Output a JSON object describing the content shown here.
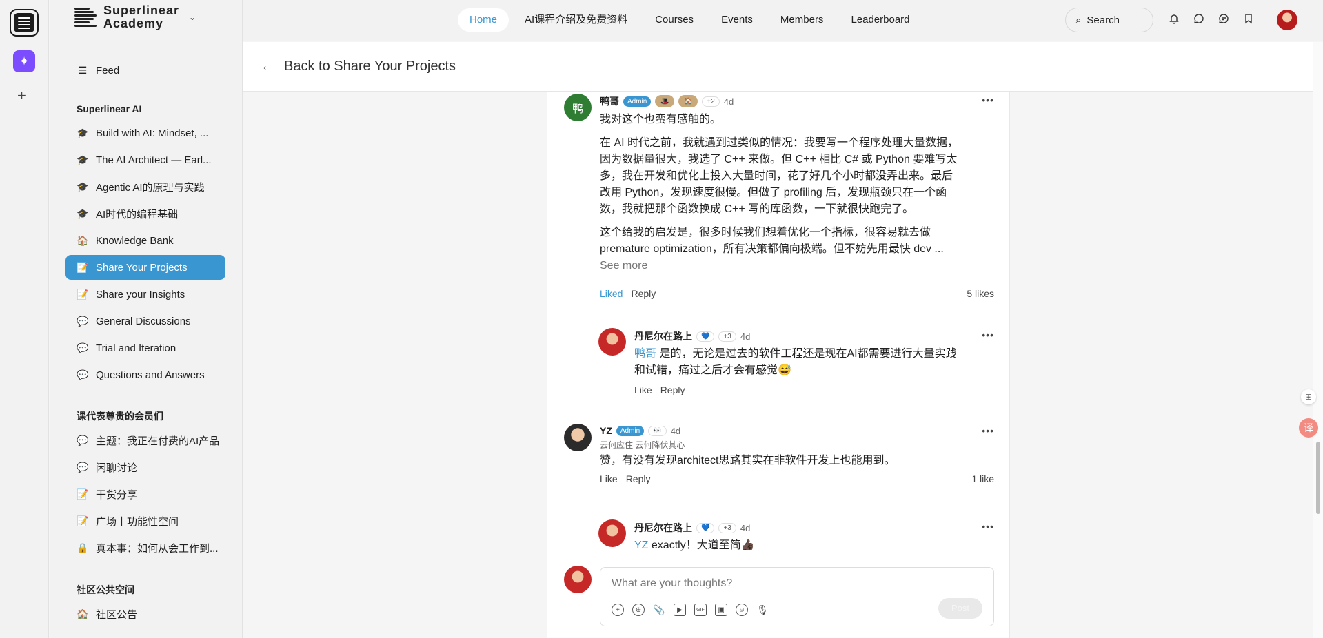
{
  "app": {
    "brand_line1": "Superlinear",
    "brand_line2": "Academy"
  },
  "nav": {
    "tabs": [
      {
        "label": "Home",
        "active": true
      },
      {
        "label": "AI课程介绍及免费资料"
      },
      {
        "label": "Courses"
      },
      {
        "label": "Events"
      },
      {
        "label": "Members"
      },
      {
        "label": "Leaderboard"
      }
    ],
    "search_label": "Search"
  },
  "sidebar": {
    "feed": "Feed",
    "section1": "Superlinear AI",
    "section1_items": [
      {
        "icon": "🎓",
        "label": "Build with AI: Mindset, ..."
      },
      {
        "icon": "🎓",
        "label": "The AI Architect — Earl..."
      },
      {
        "icon": "🎓",
        "label": "Agentic AI的原理与实践"
      },
      {
        "icon": "🎓",
        "label": "AI时代的编程基础"
      },
      {
        "icon": "🏠",
        "label": "Knowledge Bank"
      },
      {
        "icon": "📝",
        "label": "Share Your Projects",
        "active": true
      },
      {
        "icon": "📝",
        "label": "Share your Insights"
      },
      {
        "icon": "💬",
        "label": "General Discussions"
      },
      {
        "icon": "💬",
        "label": "Trial and Iteration"
      },
      {
        "icon": "💬",
        "label": "Questions and Answers"
      }
    ],
    "section2": "课代表尊贵的会员们",
    "section2_items": [
      {
        "icon": "💬",
        "label": "主题：我正在付费的AI产品"
      },
      {
        "icon": "💬",
        "label": "闲聊讨论"
      },
      {
        "icon": "📝",
        "label": "干货分享"
      },
      {
        "icon": "📝",
        "label": "广场丨功能性空间"
      },
      {
        "icon": "🔒",
        "label": "真本事：如何从会工作到..."
      }
    ],
    "section3": "社区公共空间",
    "section3_items": [
      {
        "icon": "🏠",
        "label": "社区公告"
      }
    ]
  },
  "back": {
    "label": "Back to Share Your Projects"
  },
  "comments": {
    "c1": {
      "avatar": "鸭",
      "name": "鸭哥",
      "admin": "Admin",
      "extra": "+2",
      "time": "4d",
      "p1": "我对这个也蛮有感触的。",
      "p2": "在 AI 时代之前，我就遇到过类似的情况：我要写一个程序处理大量数据，因为数据量很大，我选了 C++ 来做。但 C++ 相比 C# 或 Python 要难写太多，我在开发和优化上投入大量时间，花了好几个小时都没弄出来。最后改用 Python，发现速度很慢。但做了 profiling 后，发现瓶颈只在一个函数，我就把那个函数换成 C++ 写的库函数，一下就很快跑完了。",
      "p3": "这个给我的启发是，很多时候我们想着优化一个指标，很容易就去做 premature optimization，所有决策都偏向极端。但不妨先用最快 dev ...",
      "see_more": "See more",
      "like": "Liked",
      "reply": "Reply",
      "likes": "5 likes"
    },
    "r1": {
      "name": "丹尼尔在路上",
      "extra": "+3",
      "time": "4d",
      "mention": "鸭哥",
      "text": " 是的，无论是过去的软件工程还是现在AI都需要进行大量实践和试错，痛过之后才会有感觉😅",
      "like": "Like",
      "reply": "Reply"
    },
    "c2": {
      "name": "YZ",
      "admin": "Admin",
      "badge": "👀",
      "time": "4d",
      "subtitle": "云何应住 云何降伏其心",
      "text": "赞，有没有发现architect思路其实在非软件开发上也能用到。",
      "like": "Like",
      "reply": "Reply",
      "likes": "1 like"
    },
    "r2": {
      "name": "丹尼尔在路上",
      "extra": "+3",
      "time": "4d",
      "mention": "YZ",
      "text": " exactly！大道至简👍🏿"
    }
  },
  "composer": {
    "placeholder": "What are your thoughts?",
    "post": "Post"
  }
}
